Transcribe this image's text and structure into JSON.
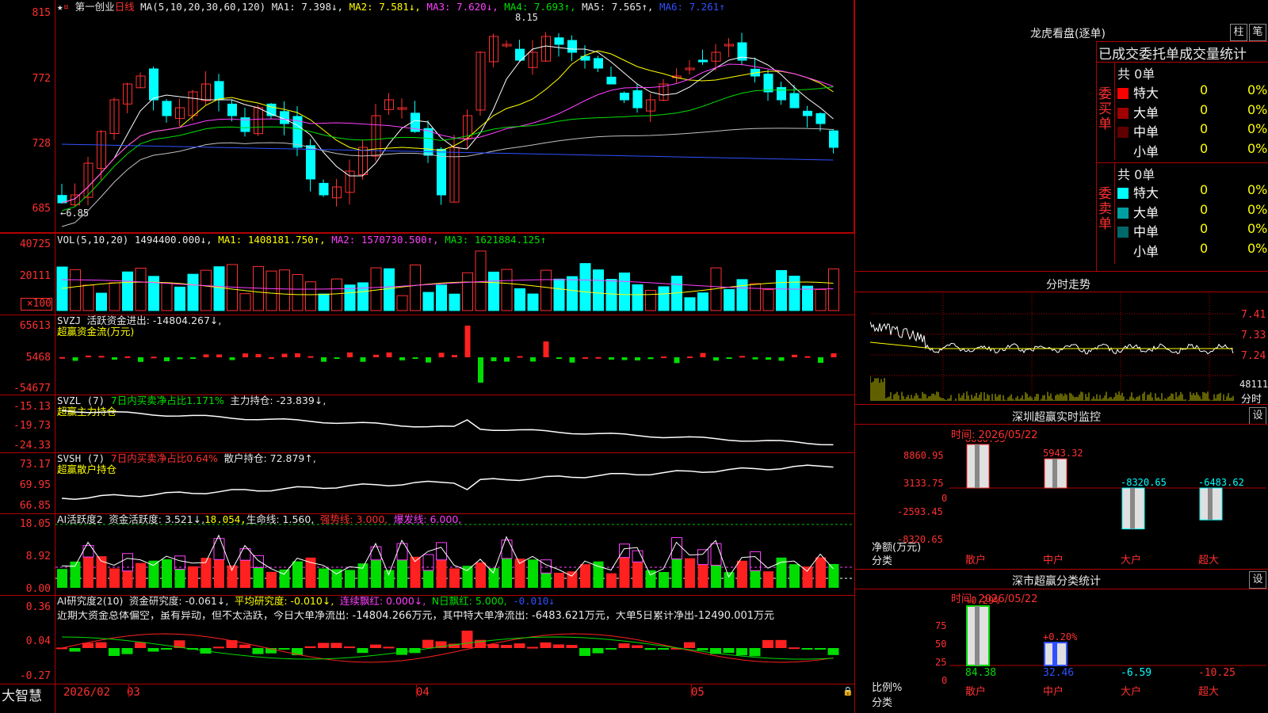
{
  "left": {
    "kline": {
      "star": "★",
      "dot": "¤",
      "name": "第一创业",
      "period": "日线",
      "ma_label": "MA(5,10,20,30,60,120)",
      "ma1": "MA1: 7.398↓,",
      "ma2": "MA2: 7.581↓,",
      "ma3": "MA3: 7.620↓,",
      "ma4": "MA4: 7.693↑,",
      "ma5": "MA5: 7.565↑,",
      "ma6": "MA6: 7.261↑",
      "yticks": [
        "815",
        "772",
        "728",
        "685"
      ],
      "high_note": "8.15",
      "low_note": "←6.85",
      "colors": {
        "ma1": "#ffffff",
        "ma2": "#ffff00",
        "ma3": "#ff40ff",
        "ma4": "#00e000",
        "ma5": "#c0c0c0",
        "ma6": "#3050ff",
        "up": "#ff3030",
        "down": "#00ffff"
      }
    },
    "vol": {
      "label": "VOL(5,10,20)",
      "v": "1494400.000↓,",
      "ma1": "MA1: 1408181.750↑,",
      "ma2": "MA2: 1570730.500↑,",
      "ma3": "MA3: 1621884.125↑",
      "yticks": [
        "40725",
        "20111",
        "×100"
      ]
    },
    "svzj": {
      "label": "SVZJ",
      "desc": "活跃资金进出: -14804.267↓,",
      "sub": "超赢资金流(万元)",
      "yticks": [
        "65613",
        "5468",
        "-54677"
      ]
    },
    "svzl": {
      "label": "SVZL (7)",
      "pct": "7日内买卖净占比1.171%",
      "main": "主力持仓: -23.839↓,",
      "sub": "超赢主力持仓",
      "yticks": [
        "-15.13",
        "-19.73",
        "-24.33"
      ]
    },
    "svsh": {
      "label": "SVSH (7)",
      "pct": "7日内买卖净占比0.64%",
      "main": "散户持仓: 72.879↑,",
      "sub": "超赢散户持仓",
      "yticks": [
        "73.17",
        "69.95",
        "66.85"
      ]
    },
    "ai1": {
      "label": "AI活跃度2",
      "a": "资金活跃度: 3.521↓,",
      "b": "18.054,",
      "c": "生命线: 1.560,",
      "d": "强势线: 3.000,",
      "e": "爆发线: 6.000,",
      "yticks": [
        "18.05",
        "8.92",
        "0.00"
      ]
    },
    "ai2": {
      "label": "AI研究度2(10)",
      "a": "资金研究度: -0.061↓,",
      "b": "平均研究度: -0.010↓,",
      "c": "连续飘红: 0.000↓,",
      "d": "N日飘红: 5.000,",
      "e": "-0.010↓",
      "comment": "近期大资金总体偏空，虽有异动，但不太活跃，今日大单净流出: -14804.266万元，其中特大单净流出: -6483.621万元，大单5日累计净出-12490.001万元",
      "yticks": [
        "0.36",
        "0.04",
        "-0.27"
      ]
    },
    "xaxis": {
      "brand": "大智慧",
      "labels": [
        "2026/02",
        "03",
        "04",
        "05"
      ]
    }
  },
  "right": {
    "dragon": {
      "title": "龙虎看盘(逐单)",
      "btn1": "柱",
      "btn2": "笔",
      "header": "已成交委托单成交量统计",
      "buy_side": "委买单",
      "sell_side": "委卖单",
      "buy_total": "共 0单",
      "sell_total": "共 0单",
      "buy_rows": [
        {
          "name": "特大",
          "n": "0",
          "p": "0%",
          "color": "#ff0000"
        },
        {
          "name": "大单",
          "n": "0",
          "p": "0%",
          "color": "#a00000"
        },
        {
          "name": "中单",
          "n": "0",
          "p": "0%",
          "color": "#600000"
        },
        {
          "name": "小单",
          "n": "0",
          "p": "0%",
          "color": ""
        }
      ],
      "sell_rows": [
        {
          "name": "特大",
          "n": "0",
          "p": "0%",
          "color": "#00ffff"
        },
        {
          "name": "大单",
          "n": "0",
          "p": "0%",
          "color": "#00a0a0"
        },
        {
          "name": "中单",
          "n": "0",
          "p": "0%",
          "color": "#006868"
        },
        {
          "name": "小单",
          "n": "0",
          "p": "0%",
          "color": ""
        }
      ]
    },
    "intraday": {
      "title": "分时走势",
      "yticks": [
        "7.41",
        "7.33",
        "7.24",
        "48111"
      ],
      "bottom": "分时"
    },
    "monitor": {
      "title": "深圳超赢实时监控",
      "set": "设",
      "time": "时间: 2026/05/22",
      "yticks": [
        "8860.95",
        "3133.75",
        "0",
        "-2593.45",
        "-8320.65"
      ],
      "ylabel": "净额(万元)",
      "xlabel": "分类",
      "bars": [
        {
          "label": "散户",
          "value": 8860.95,
          "text": "8860.95"
        },
        {
          "label": "中户",
          "value": 5943.32,
          "text": "5943.32"
        },
        {
          "label": "大户",
          "value": -8320.65,
          "text": "-8320.65"
        },
        {
          "label": "超大",
          "value": -6483.62,
          "text": "-6483.62"
        }
      ]
    },
    "category": {
      "title": "深市超赢分类统计",
      "set": "设",
      "time": "时间: 2026/05/22",
      "yticks": [
        "75",
        "50",
        "25",
        "0"
      ],
      "ylabel": "比例%",
      "xlabel": "分类",
      "bars": [
        {
          "label": "散户",
          "pct": 84.38,
          "text": "84.38",
          "note": "+0.29%"
        },
        {
          "label": "中户",
          "pct": 32.46,
          "text": "32.46",
          "note": "+0.20%"
        },
        {
          "label": "大户",
          "pct": -6.59,
          "text": "-6.59",
          "note": ""
        },
        {
          "label": "超大",
          "pct": -10.25,
          "text": "-10.25",
          "note": ""
        }
      ]
    }
  }
}
